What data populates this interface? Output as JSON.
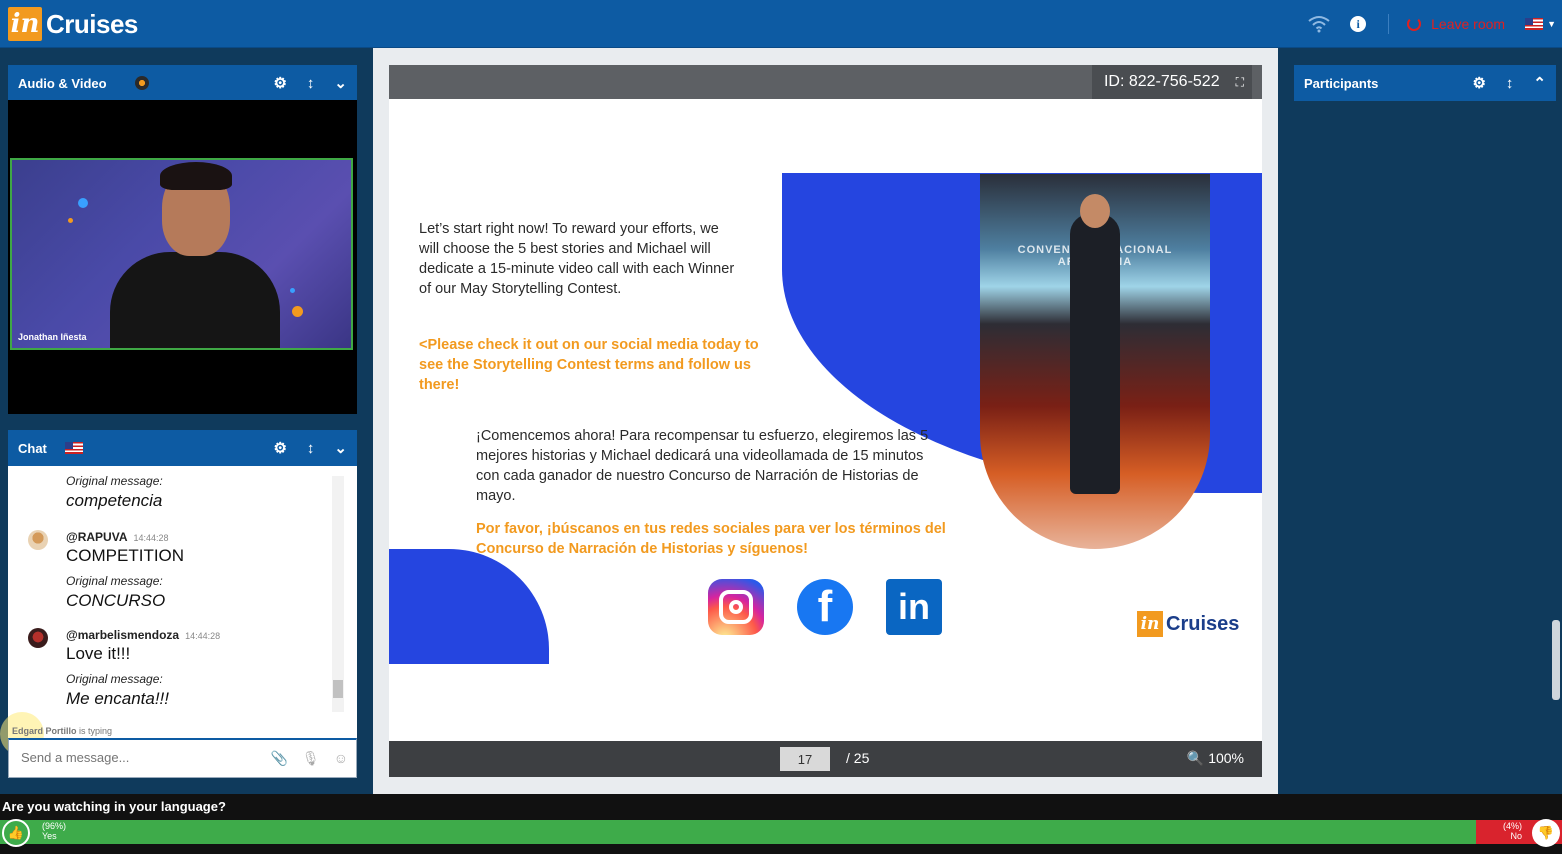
{
  "app": {
    "logo_in": "in",
    "logo_text": "Cruises",
    "leave_label": "Leave room"
  },
  "panels": {
    "audio_video": {
      "title": "Audio & Video",
      "speaker_name": "Jonathan Iñesta"
    },
    "chat": {
      "title": "Chat"
    },
    "participants": {
      "title": "Participants"
    }
  },
  "chat": {
    "messages": [
      {
        "user": "",
        "time": "",
        "text": "",
        "orig_label": "Original message:",
        "orig": "competencia"
      },
      {
        "user": "@RAPUVA",
        "time": "14:44:28",
        "text": "COMPETITION",
        "orig_label": "Original message:",
        "orig": "CONCURSO"
      },
      {
        "user": "@marbelismendoza",
        "time": "14:44:28",
        "text": "Love it!!!",
        "orig_label": "Original message:",
        "orig": "Me encanta!!!"
      }
    ],
    "typing_name": "Edgard Portillo",
    "typing_suffix": "is typing",
    "input_placeholder": "Send a message..."
  },
  "presentation": {
    "id_label": "ID: 822-756-522",
    "current_page": "17",
    "total_pages": "/ 25",
    "zoom": "100%",
    "slide": {
      "en_text": "Let’s start right now! To reward your efforts, we will choose the 5 best stories and Michael will dedicate a 15-minute video call with each Winner of our May Storytelling Contest.",
      "en_orange": "<Please check it out on our social media today to see the Storytelling Contest terms and follow us there!",
      "es_text": "¡Comencemos ahora! Para recompensar tu esfuerzo, elegiremos las 5 mejores historias y Michael dedicará una videollamada de 15 minutos con cada ganador de nuestro Concurso de Narración de Historias de mayo.",
      "es_orange": "Por favor, ¡búscanos en tus redes sociales para ver los términos del Concurso de Narración de Historias y síguenos!",
      "logo_in": "in",
      "logo_text": "Cruises",
      "photo_banner": "CONVENCION NACIONAL ARGENTINA"
    }
  },
  "poll": {
    "question": "Are you watching in your language?",
    "yes_pct": "(96%)",
    "yes_label": "Yes",
    "yes_fraction": 0.96,
    "no_pct": "(4%)",
    "no_label": "No"
  },
  "colors": {
    "brand_blue": "#0d5ba3",
    "brand_orange": "#f29a1f",
    "poll_green": "#3eab4a",
    "poll_red": "#d9232d"
  }
}
